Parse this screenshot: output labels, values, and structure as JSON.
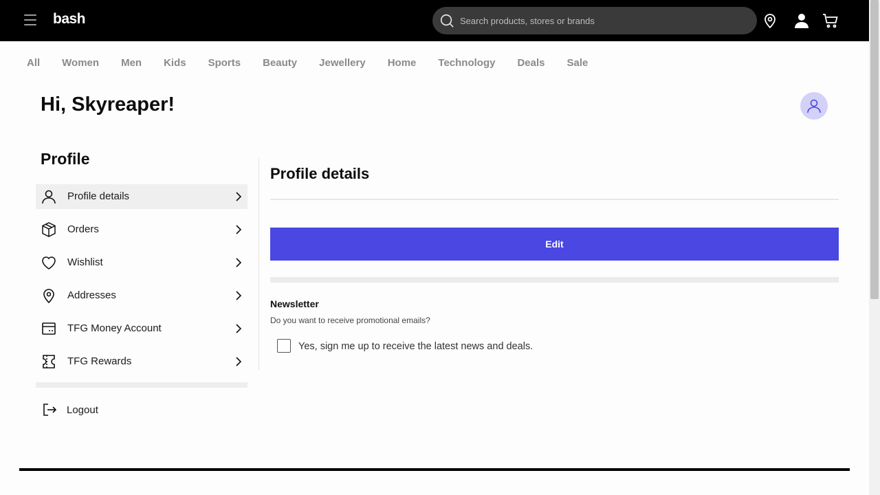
{
  "header": {
    "logo": "bash",
    "search_placeholder": "Search products, stores or brands"
  },
  "nav": {
    "items": [
      "All",
      "Women",
      "Men",
      "Kids",
      "Sports",
      "Beauty",
      "Jewellery",
      "Home",
      "Technology",
      "Deals",
      "Sale"
    ]
  },
  "greeting": "Hi, Skyreaper!",
  "sidebar": {
    "title": "Profile",
    "items": [
      {
        "label": "Profile details",
        "icon": "user-icon",
        "active": true
      },
      {
        "label": "Orders",
        "icon": "box-icon"
      },
      {
        "label": "Wishlist",
        "icon": "heart-icon"
      },
      {
        "label": "Addresses",
        "icon": "location-pin-icon"
      },
      {
        "label": "TFG Money Account",
        "icon": "card-icon"
      },
      {
        "label": "TFG Rewards",
        "icon": "ticket-icon"
      }
    ],
    "logout_label": "Logout"
  },
  "main": {
    "title": "Profile details",
    "edit_label": "Edit",
    "newsletter": {
      "title": "Newsletter",
      "subtitle": "Do you want to receive promotional emails?",
      "checkbox_label": "Yes, sign me up to receive the latest news and deals.",
      "checked": false
    }
  },
  "colors": {
    "accent": "#4a47e2",
    "avatar_bg": "#d3d1f7",
    "topbar": "#000000"
  }
}
